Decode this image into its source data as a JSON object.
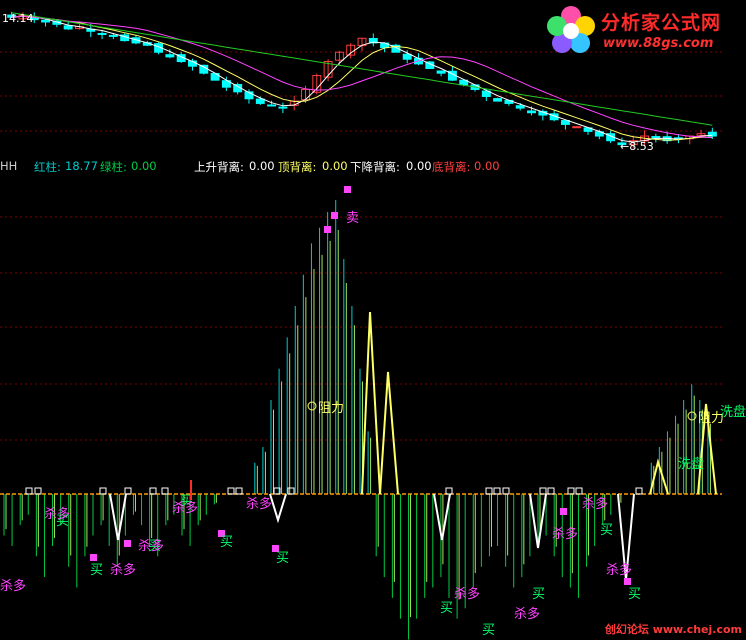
{
  "brand": {
    "title": "分析家公式网",
    "url": "www.88gs.com"
  },
  "footer_mark": "创幻论坛 www.chej.com",
  "legend": {
    "indicator_name": "HH",
    "red_bar_label": "红柱:",
    "red_bar_value": "18.77",
    "green_bar_label": "绿柱:",
    "green_bar_value": "0.00",
    "up_div_label": "上升背离:",
    "up_div_value": "0.00",
    "top_div_label": "顶背离:",
    "top_div_value": "0.00",
    "down_div_label": "下降背离:",
    "down_div_value": "0.00",
    "bottom_div_label": "底背离:",
    "bottom_div_value": "0.00"
  },
  "colors": {
    "background": "#000000",
    "candle_up": "#ff3b3b",
    "candle_down": "#00ffff",
    "ma_short": "#ffffff",
    "ma_mid": "#ffff66",
    "ma_long": "#ff44ff",
    "ma_xlong": "#22cc22",
    "bar_red": "#00cccc",
    "bar_green": "#00cc44",
    "bar_hot": "#a8e65a",
    "zero_line": "#ff9900",
    "marker": "#ff44ff",
    "label_buy": "#00ff66",
    "label_sell": "#ff44ff",
    "label_resist": "#ffff66",
    "label_wash": "#00ff66",
    "grid": "#800000"
  },
  "chart_data": [
    {
      "type": "candlestick",
      "annotations": [
        {
          "text": "14.14",
          "position": "top-left"
        },
        {
          "text": "8.53",
          "position": "bottom-right",
          "arrow": "←"
        }
      ],
      "close_approx": [
        14.0,
        14.1,
        13.9,
        13.8,
        13.7,
        13.5,
        13.6,
        13.4,
        13.3,
        13.2,
        13.0,
        12.9,
        12.8,
        12.5,
        12.3,
        12.1,
        11.9,
        11.6,
        11.3,
        11.0,
        10.8,
        10.5,
        10.3,
        10.2,
        10.1,
        10.4,
        10.9,
        11.5,
        12.1,
        12.5,
        12.8,
        13.1,
        12.9,
        12.7,
        12.5,
        12.2,
        12.0,
        11.8,
        11.6,
        11.3,
        11.1,
        10.9,
        10.6,
        10.4,
        10.3,
        10.1,
        9.9,
        9.8,
        9.6,
        9.4,
        9.3,
        9.1,
        8.9,
        8.7,
        8.53,
        8.7,
        8.9,
        8.8,
        8.7,
        8.8,
        8.9,
        9.0,
        8.9
      ]
    },
    {
      "type": "bar",
      "series": [
        {
          "name": "红柱",
          "values_approx": [
            0,
            0,
            0,
            0,
            0,
            0,
            0,
            0,
            0,
            0,
            0,
            0,
            0,
            0,
            0,
            0,
            0,
            0,
            0,
            0,
            0,
            0,
            0,
            0,
            0,
            0,
            0,
            0,
            0,
            0,
            0,
            2,
            3,
            6,
            8,
            10,
            12,
            14,
            16,
            17,
            18,
            18.77,
            15,
            12,
            8,
            4,
            0,
            0,
            0,
            0,
            0,
            0,
            0,
            0,
            0,
            0,
            0,
            0,
            0,
            0,
            0,
            0,
            0,
            0,
            0,
            0,
            0,
            0,
            0,
            0,
            0,
            0,
            0,
            0,
            0,
            0,
            0,
            0,
            0,
            0,
            2,
            3,
            4,
            5,
            6,
            7,
            6,
            5
          ]
        },
        {
          "name": "绿柱",
          "values_approx": [
            -4,
            -5,
            -3,
            -2,
            -6,
            -8,
            -5,
            -3,
            -7,
            -9,
            -6,
            -4,
            -3,
            -5,
            -7,
            -4,
            -2,
            -3,
            -5,
            -6,
            -3,
            -2,
            -4,
            -5,
            -3,
            -2,
            -1,
            0,
            0,
            0,
            0,
            0,
            0,
            0,
            0,
            0,
            0,
            0,
            0,
            0,
            0,
            0,
            0,
            0,
            0,
            0,
            -6,
            -8,
            -10,
            -12,
            -14,
            -12,
            -10,
            -9,
            -8,
            -10,
            -12,
            -11,
            -9,
            -7,
            -6,
            -5,
            -7,
            -9,
            -8,
            -6,
            -5,
            -4,
            -6,
            -8,
            -9,
            -10,
            -7,
            -5,
            -3,
            -2,
            -1,
            0,
            0,
            0,
            0,
            0,
            0,
            0,
            0,
            0,
            0,
            0
          ]
        }
      ],
      "labels": [
        {
          "text": "卖",
          "kind": "sell"
        },
        {
          "text": "阻力",
          "kind": "resist"
        },
        {
          "text": "阻力",
          "kind": "resist"
        },
        {
          "text": "洗盘",
          "kind": "wash"
        },
        {
          "text": "洗盘",
          "kind": "wash"
        },
        {
          "text": "买",
          "kind": "buy"
        },
        {
          "text": "杀多",
          "kind": "kill"
        }
      ]
    }
  ]
}
